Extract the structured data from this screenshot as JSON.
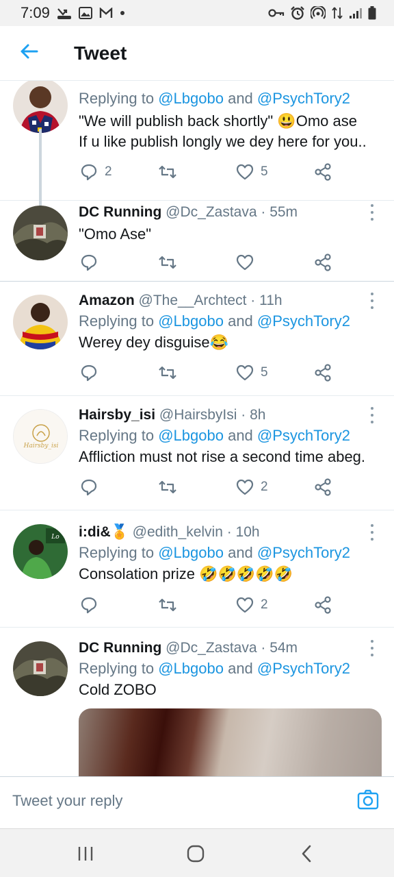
{
  "status_bar": {
    "time": "7:09"
  },
  "header": {
    "title": "Tweet"
  },
  "tweets": [
    {
      "reply_prefix": "Replying to",
      "mention1": "@Lbgobo",
      "and": "and",
      "mention2": "@PsychTory2",
      "text_line1": "\"We will publish back shortly\" 😃Omo ase",
      "text_line2": "If u like publish longly we dey here for you..",
      "replies": "2",
      "likes": "5"
    },
    {
      "name": "DC Running",
      "handle": "@Dc_Zastava",
      "time": "· 55m",
      "text": "\"Omo Ase\""
    },
    {
      "name": "Amazon",
      "handle": "@The__Archtect",
      "time": "· 11h",
      "reply_prefix": "Replying to",
      "mention1": "@Lbgobo",
      "and": "and",
      "mention2": "@PsychTory2",
      "text": "Werey dey disguise😂",
      "likes": "5"
    },
    {
      "name": "Hairsby_isi",
      "handle": "@HairsbyIsi",
      "time": "· 8h",
      "reply_prefix": "Replying to",
      "mention1": "@Lbgobo",
      "and": "and",
      "mention2": "@PsychTory2",
      "text": "Affliction must not rise a second time abeg.",
      "likes": "2",
      "avatar_text": "Hairsby_isi"
    },
    {
      "name": "i:di&🏅",
      "handle": "@edith_kelvin",
      "time": "· 10h",
      "reply_prefix": "Replying to",
      "mention1": "@Lbgobo",
      "and": "and",
      "mention2": "@PsychTory2",
      "text": "Consolation prize 🤣🤣🤣🤣🤣",
      "likes": "2"
    },
    {
      "name": "DC Running",
      "handle": "@Dc_Zastava",
      "time": "· 54m",
      "reply_prefix": "Replying to",
      "mention1": "@Lbgobo",
      "and": "and",
      "mention2": "@PsychTory2",
      "text": "Cold ZOBO"
    }
  ],
  "reply_bar": {
    "placeholder": "Tweet your reply"
  },
  "colors": {
    "accent": "#1da1f2",
    "mention": "#1b95e0",
    "muted": "#657786"
  },
  "icons": [
    "back-arrow-icon",
    "reply-icon",
    "retweet-icon",
    "like-icon",
    "share-icon",
    "more-icon",
    "camera-icon",
    "recent-apps-icon",
    "home-icon",
    "back-icon"
  ]
}
